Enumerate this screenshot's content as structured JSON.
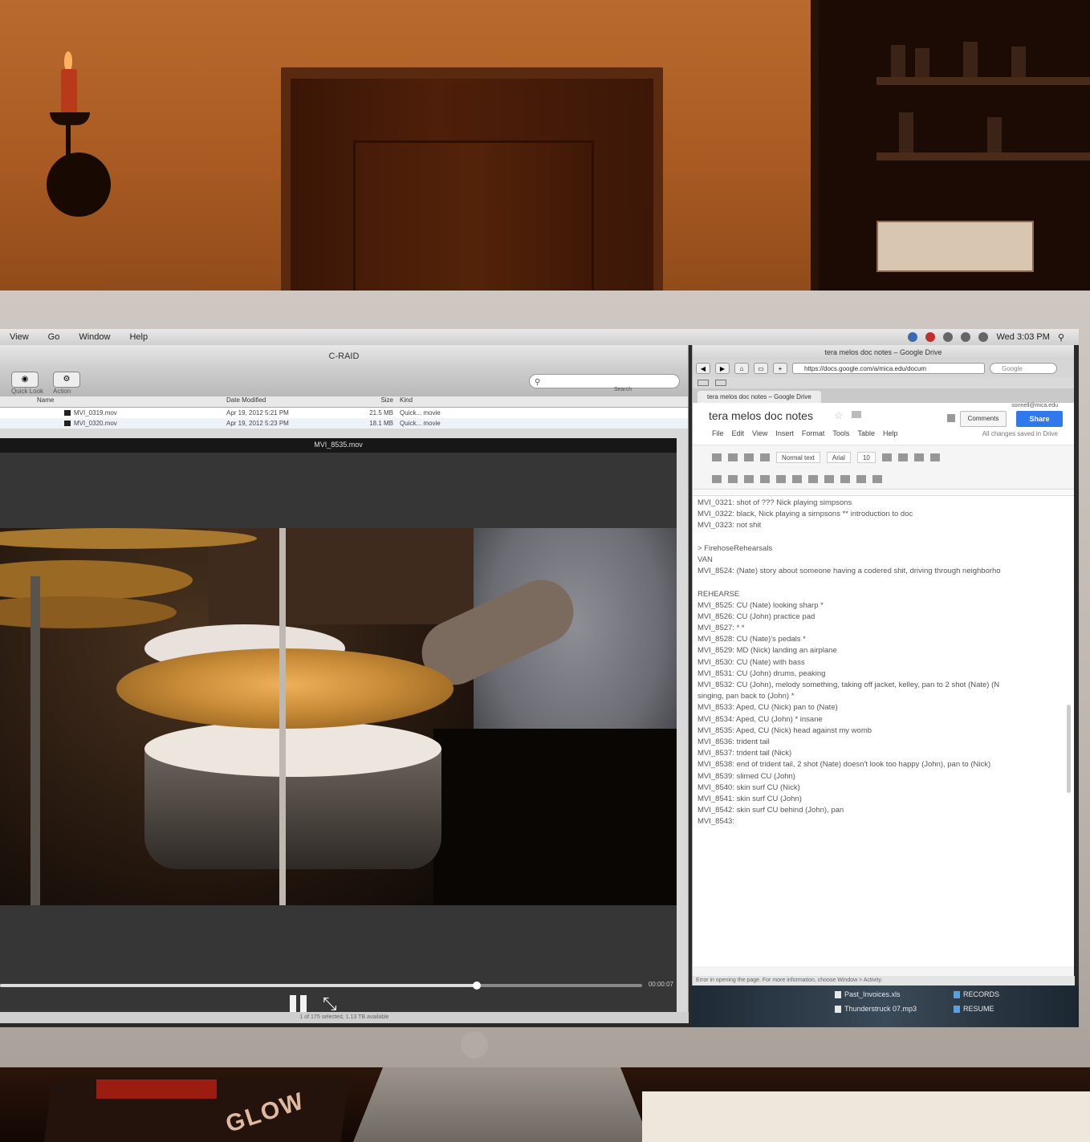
{
  "menubar": {
    "items": [
      "View",
      "Go",
      "Window",
      "Help"
    ],
    "clock": "Wed 3:03 PM"
  },
  "finder": {
    "title": "C-RAID",
    "toolbar": {
      "quick_look": "Quick Look",
      "action": "Action"
    },
    "search_label": "Search",
    "columns": [
      "Name",
      "Date Modified",
      "Size",
      "Kind"
    ],
    "rows": [
      {
        "name": "MVI_0319.mov",
        "date": "Apr 19, 2012 5:21 PM",
        "size": "21.5 MB",
        "kind": "Quick... movie"
      },
      {
        "name": "MVI_0320.mov",
        "date": "Apr 19, 2012 5:23 PM",
        "size": "18.1 MB",
        "kind": "Quick... movie"
      }
    ],
    "status": "1 of 175 selected, 1.13 TB available"
  },
  "quicktime": {
    "title": "MVI_8535.mov",
    "time": "00:00:07"
  },
  "browser": {
    "window_title": "tera melos doc notes – Google Drive",
    "url": "https://docs.google.com/a/mica.edu/docum",
    "search_placeholder": "Google",
    "tab": "tera melos doc notes – Google Drive",
    "status": "Error in opening the page. For more information, choose Window > Activity."
  },
  "gdoc": {
    "title": "tera melos doc notes",
    "user": "sonnell@mica.edu",
    "comments": "Comments",
    "share": "Share",
    "saved": "All changes saved in Drive",
    "menu": [
      "File",
      "Edit",
      "View",
      "Insert",
      "Format",
      "Tools",
      "Table",
      "Help"
    ],
    "style": "Normal text",
    "font": "Arial",
    "size": "10",
    "lines": [
      "MVI_0321: shot of ??? Nick playing simpsons",
      "MVI_0322: black, Nick playing a simpsons ** introduction to doc",
      "MVI_0323: not shit",
      "",
      "> FirehoseRehearsals",
      "VAN",
      "MVI_8524: (Nate) story about someone having a codered shit, driving through neighborho",
      "",
      "REHEARSE",
      "MVI_8525: CU (Nate) looking sharp *",
      "MVI_8526: CU (John) practice pad",
      "MVI_8527: * *",
      "MVI_8528: CU (Nate)'s pedals *",
      "MVI_8529: MD (Nick) landing an airplane",
      "MVI_8530: CU (Nate) with bass",
      "MVI_8531: CU (John) drums, peaking",
      "MVI_8532: CU (John), melody something, taking off jacket, kelley, pan to 2 shot (Nate) (N",
      "singing, pan back to (John) *",
      "MVI_8533: Aped, CU (Nick) pan to (Nate)",
      "MVI_8534: Aped, CU (John) * insane",
      "MVI_8535: Aped, CU (Nick) head against my womb",
      "MVI_8536: trident tail",
      "MVI_8537: trident tail (Nick)",
      "MVI_8538: end of trident tail, 2 shot (Nate) doesn't look too happy (John), pan to (Nick)",
      "MVI_8539: slimed CU (John)",
      "MVI_8540: skin surf CU (Nick)",
      "MVI_8541: skin surf CU (John)",
      "MVI_8542: skin surf CU behind (John), pan",
      "MVI_8543:"
    ]
  },
  "desktop": {
    "items": [
      "Past_Invoices.xls",
      "Thunderstruck 07.mp3",
      "RECORDS",
      "RESUME"
    ]
  },
  "magazine_text": "GLOW"
}
